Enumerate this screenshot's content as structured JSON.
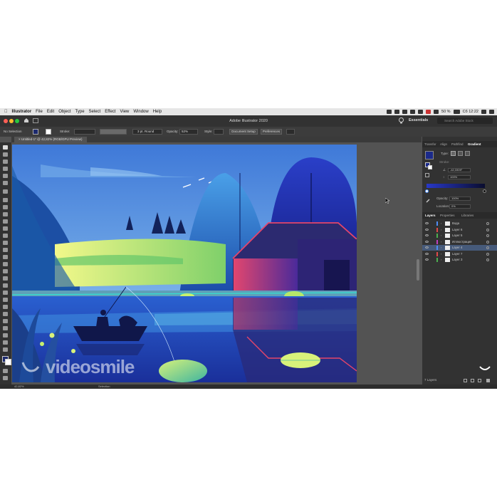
{
  "menubar": {
    "app": "Illustrator",
    "items": [
      "File",
      "Edit",
      "Object",
      "Type",
      "Select",
      "Effect",
      "View",
      "Window",
      "Help"
    ],
    "battery": "50 %",
    "clock": "Сб 12:22"
  },
  "titlebar": {
    "title": "Adobe Illustrator 2020",
    "workspace": "Essentials",
    "search_placeholder": "Search Adobe Stock"
  },
  "control_bar": {
    "selection": "No Selection",
    "stroke_label": "Stroke:",
    "brush": "3 pt. Round",
    "opacity_label": "Opacity:",
    "opacity_value": "52%",
    "style_label": "Style:",
    "document_setup": "Document Setup",
    "preferences": "Preferences"
  },
  "document": {
    "tab_title": "Untitled-1* @ 42,82% (RGB/GPU Preview)"
  },
  "panels": {
    "top_tabs": [
      "Transfor",
      "Align",
      "Pathfind",
      "Gradient"
    ],
    "gradient": {
      "type_label": "Type:",
      "stroke_label": "Stroke:",
      "angle": "-42,3309°",
      "aspect": "100%",
      "opacity_label": "Opacity:",
      "opacity_value": "100%",
      "location_label": "Location:",
      "location_value": "0%"
    },
    "layer_tabs": [
      "Layers",
      "Properties",
      "Libraries"
    ],
    "layers": [
      {
        "name": "Вода",
        "color": "#4f8df5",
        "selected": false
      },
      {
        "name": "Layer 6",
        "color": "#e24a4a",
        "selected": false
      },
      {
        "name": "Layer 5",
        "color": "#4caf50",
        "selected": false
      },
      {
        "name": "Иллюстрация",
        "color": "#c040c0",
        "selected": false
      },
      {
        "name": "Layer 4",
        "color": "#4f8df5",
        "selected": true
      },
      {
        "name": "Layer 7",
        "color": "#e24a4a",
        "selected": false
      },
      {
        "name": "Layer 3",
        "color": "#4caf50",
        "selected": false
      }
    ],
    "layer_count": "7 Layers"
  },
  "status": {
    "zoom": "42,82%",
    "tool": "Selection"
  },
  "watermark": "videosmile",
  "colors": {
    "sky_top": "#3d7bd6",
    "sky_bottom": "#8ec7f2",
    "meadow": "#d9f27a",
    "house_accent": "#e4456a",
    "water": "#1f3fb8"
  },
  "icons": [
    "apple-icon",
    "home-icon",
    "selection-tool-icon",
    "direct-selection-icon",
    "pen-icon",
    "type-icon",
    "rectangle-icon",
    "brush-icon",
    "eyedropper-icon",
    "zoom-icon",
    "hand-icon"
  ]
}
